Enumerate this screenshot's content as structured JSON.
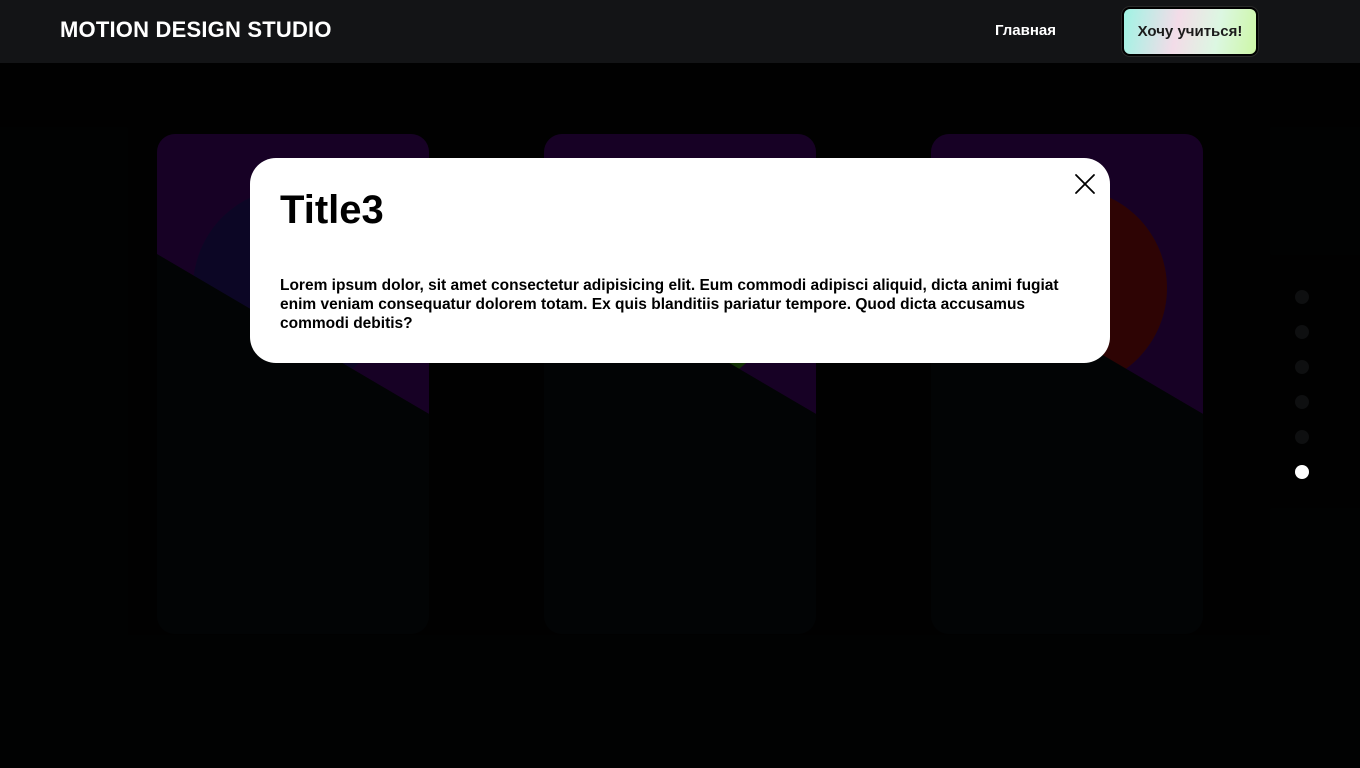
{
  "header": {
    "logo": "MOTION DESIGN STUDIO",
    "nav_home": "Главная",
    "cta_label": "Хочу учиться!"
  },
  "cards": [
    {
      "circle_color": "#3a1ea8"
    },
    {
      "circle_color": "#56e01a"
    },
    {
      "circle_color": "#d01616"
    }
  ],
  "modal": {
    "title": "Title3",
    "text": "Lorem ipsum dolor, sit amet consectetur adipisicing elit. Eum commodi adipisci aliquid, dicta animi fugiat enim veniam consequatur dolorem totam. Ex quis blanditiis pariatur tempore. Quod dicta accusamus commodi debitis?",
    "close_icon": "close-icon"
  },
  "pagination": {
    "total": 6,
    "active_index": 5
  },
  "colors": {
    "card_accent": "#6a08a8",
    "header_bg": "#131416",
    "modal_bg": "#ffffff"
  }
}
